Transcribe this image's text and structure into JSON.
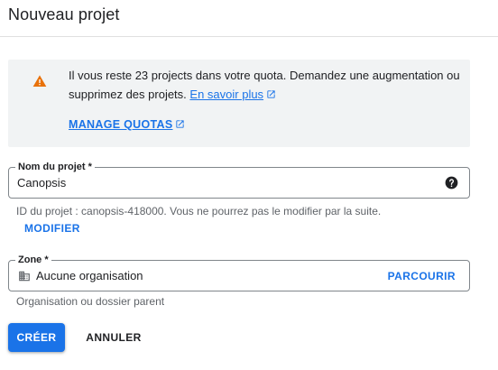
{
  "dialog": {
    "title": "Nouveau projet"
  },
  "quota_banner": {
    "message": "Il vous reste 23 projects dans votre quota. Demandez une augmentation ou supprimez des projets.",
    "learn_more_label": "En savoir plus",
    "manage_quotas_label": "MANAGE QUOTAS",
    "icon": "warning-icon",
    "icon_color": "#e8710a"
  },
  "project_name": {
    "label": "Nom du projet *",
    "value": "Canopsis",
    "help_icon": "help-circle-icon"
  },
  "project_id": {
    "hint": "ID du projet : canopsis-418000. Vous ne pourrez pas le modifier par la suite.",
    "modify_label": "MODIFIER"
  },
  "zone": {
    "label": "Zone *",
    "value": "Aucune organisation",
    "browse_label": "PARCOURIR",
    "hint": "Organisation ou dossier parent",
    "icon": "organization-icon"
  },
  "actions": {
    "create_label": "CRÉER",
    "cancel_label": "ANNULER"
  },
  "colors": {
    "accent": "#1a73e8",
    "banner_bg": "#f1f3f4",
    "warning": "#e8710a"
  }
}
